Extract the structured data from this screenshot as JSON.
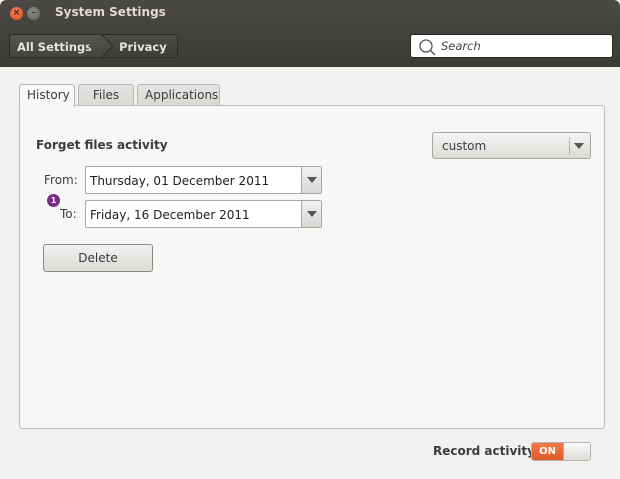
{
  "window": {
    "title": "System Settings",
    "close_glyph": "×",
    "minimize_glyph": "–"
  },
  "breadcrumb": {
    "items": [
      {
        "label": "All Settings"
      },
      {
        "label": "Privacy"
      }
    ]
  },
  "search": {
    "placeholder": "Search",
    "icon": "search-icon"
  },
  "tabs": [
    {
      "label": "History",
      "active": true
    },
    {
      "label": "Files",
      "active": false
    },
    {
      "label": "Applications",
      "active": false
    }
  ],
  "history": {
    "heading": "Forget files activity",
    "mode_selected": "custom",
    "from_label": "From:",
    "from_value": "Thursday, 01 December 2011",
    "to_label": "To:",
    "to_value": "Friday, 16 December 2011",
    "badge": "1",
    "delete_label": "Delete"
  },
  "footer": {
    "record_label": "Record activity",
    "switch_state": "ON"
  },
  "colors": {
    "titlebar": "#3c3b37",
    "accent_orange": "#e05a25",
    "badge_purple": "#7b2a88"
  }
}
